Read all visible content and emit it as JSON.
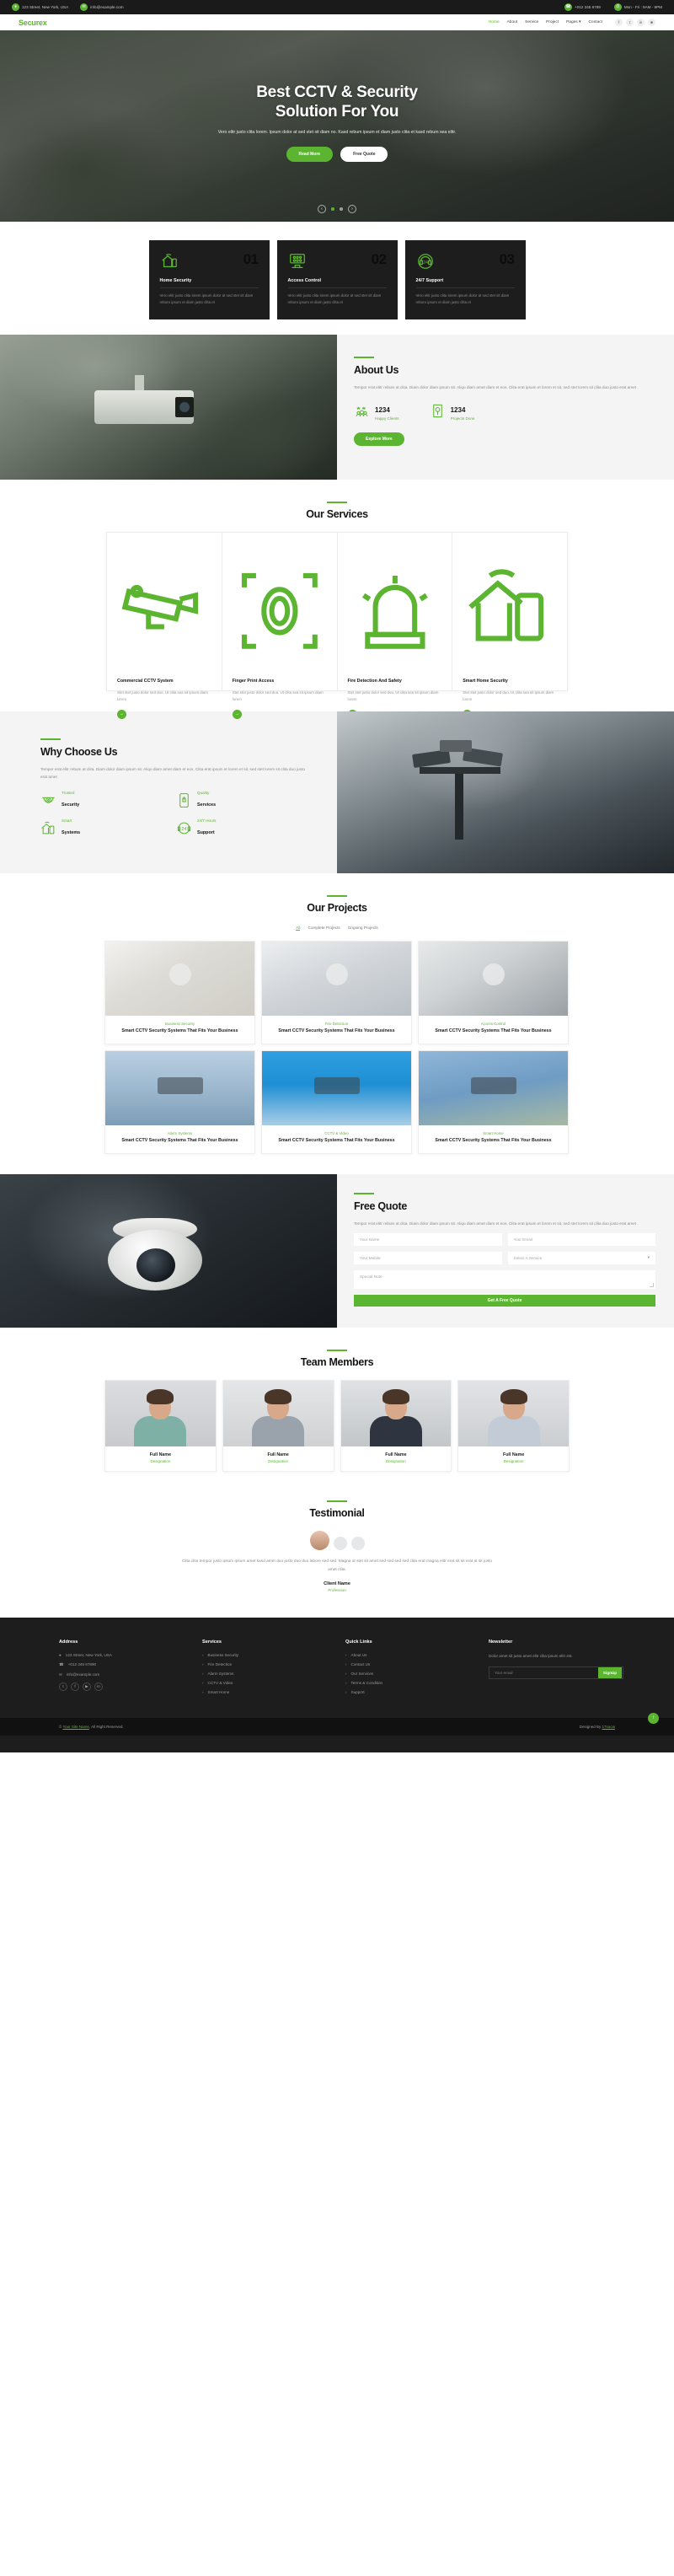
{
  "topbar": {
    "address": "123 Street, New York, USA",
    "email": "info@example.com",
    "phone": "+012 345 6789",
    "hours": "Mon - Fri : 9AM - 9PM"
  },
  "nav": {
    "logo": "Securex",
    "links": [
      {
        "label": "Home",
        "active": true
      },
      {
        "label": "About",
        "active": false
      },
      {
        "label": "Service",
        "active": false
      },
      {
        "label": "Project",
        "active": false
      },
      {
        "label": "Pages",
        "active": false,
        "caret": true
      },
      {
        "label": "Contact",
        "active": false
      }
    ],
    "social": [
      "f",
      "t",
      "in",
      "ig"
    ]
  },
  "hero": {
    "title_line1": "Best CCTV & Security",
    "title_line2": "Solution For You",
    "paragraph": "Vero elitr justo clita lorem. Ipsum dolor at sed stet sit diam no. Kasd rebum ipsum et diam justo clita et kasd rebum sea elitr.",
    "btn_primary": "Read More",
    "btn_secondary": "Free Quote"
  },
  "features": [
    {
      "title": "Home Security",
      "number": "01",
      "text": "Vero elitr justo clita lorem ipsum dolor at sed stet sit diam rebum ipsum et diam justo clita et",
      "icon": "home-wifi-icon"
    },
    {
      "title": "Access Control",
      "number": "02",
      "text": "Vero elitr justo clita lorem ipsum dolor at sed stet sit diam rebum ipsum et diam justo clita et",
      "icon": "keypad-icon"
    },
    {
      "title": "24/7 Support",
      "number": "03",
      "text": "Vero elitr justo clita lorem ipsum dolor at sed stet sit diam rebum ipsum et diam justo clita et",
      "icon": "headset-icon"
    }
  ],
  "about": {
    "title": "About Us",
    "paragraph": "Tempor erat elitr rebum at clita. Diam dolor diam ipsum sit. Aliqu diam amet diam et eos. Clita erat ipsum et lorem et sit, sed stet lorem sit clita duo justo erat amet",
    "stats": [
      {
        "number": "1234",
        "label": "Happy Clients",
        "icon": "clients-icon"
      },
      {
        "number": "1234",
        "label": "Projects Done",
        "icon": "project-icon"
      }
    ],
    "button": "Explore More"
  },
  "services": {
    "title": "Our Services",
    "items": [
      {
        "title": "Commercial CCTV System",
        "text": "Stet stet justo dolor sed duo. Ut clita sea sit ipsum diam lorem",
        "icon": "cctv-camera-icon"
      },
      {
        "title": "Finger Print Access",
        "text": "Stet stet justo dolor sed duo. Ut clita sea sit ipsum diam lorem",
        "icon": "fingerprint-icon"
      },
      {
        "title": "Fire Detection And Safety",
        "text": "Stet stet justo dolor sed duo. Ut clita sea sit ipsum diam lorem",
        "icon": "fire-alarm-icon"
      },
      {
        "title": "Smart Home Security",
        "text": "Stet stet justo dolor sed duo. Ut clita sea sit ipsum diam lorem",
        "icon": "smart-home-icon"
      }
    ]
  },
  "why": {
    "title": "Why Choose Us",
    "paragraph": "Tempor erat elitr rebum at clita. Diam dolor diam ipsum sit. Aliqu diam amet diam et eos. Clita erat ipsum et lorem et sit, sed stet lorem sit clita duo justo erat amet",
    "features": [
      {
        "small": "Trusted",
        "big": "Security",
        "icon": "dome-camera-icon"
      },
      {
        "small": "Quality",
        "big": "Services",
        "icon": "phone-lock-icon"
      },
      {
        "small": "Smart",
        "big": "Systems",
        "icon": "smart-home-icon"
      },
      {
        "small": "24/7 Hours",
        "big": "Support",
        "icon": "headset-icon"
      }
    ]
  },
  "projects": {
    "title": "Our Projects",
    "filters": [
      {
        "label": "All",
        "active": true
      },
      {
        "label": "Complete Projects",
        "active": false
      },
      {
        "label": "Ongoing Projects",
        "active": false
      }
    ],
    "items": [
      {
        "category": "Business Security",
        "title": "Smart CCTV Security Systems That Fits Your Business"
      },
      {
        "category": "Fire Detection",
        "title": "Smart CCTV Security Systems That Fits Your Business"
      },
      {
        "category": "Access Control",
        "title": "Smart CCTV Security Systems That Fits Your Business"
      },
      {
        "category": "Alarm Systems",
        "title": "Smart CCTV Security Systems That Fits Your Business"
      },
      {
        "category": "CCTV & Video",
        "title": "Smart CCTV Security Systems That Fits Your Business"
      },
      {
        "category": "Smart Home",
        "title": "Smart CCTV Security Systems That Fits Your Business"
      }
    ]
  },
  "quote": {
    "title": "Free Quote",
    "paragraph": "Tempor erat elitr rebum at clita. Diam dolor diam ipsum sit. Aliqu diam amet diam et eos. Clita erat ipsum et lorem et sit, sed stet lorem sit clita duo justo erat amet",
    "name_placeholder": "Your Name",
    "email_placeholder": "Your Email",
    "mobile_placeholder": "Your Mobile",
    "service_placeholder": "Select A Service",
    "note_placeholder": "Special Note",
    "submit": "Get A Free Quote"
  },
  "team": {
    "title": "Team Members",
    "members": [
      {
        "name": "Full Name",
        "designation": "Designation"
      },
      {
        "name": "Full Name",
        "designation": "Designation"
      },
      {
        "name": "Full Name",
        "designation": "Designation"
      },
      {
        "name": "Full Name",
        "designation": "Designation"
      }
    ]
  },
  "testimonial": {
    "title": "Testimonial",
    "quote": "Clita clita tempor justo ipsum ipsum amet kasd amet duo justo duo duo labore sed sed. Magna ut stet sit amet sed sed sed sed clita erat magna elitr erat sit sit erat at sit justo amet clita.",
    "client_name": "Client Name",
    "client_profession": "Profession"
  },
  "footer": {
    "address": {
      "heading": "Address",
      "items": [
        {
          "icon": "location-pin-icon",
          "text": "123 Street, New York, USA"
        },
        {
          "icon": "phone-icon",
          "text": "+012 345 67890"
        },
        {
          "icon": "envelope-icon",
          "text": "info@example.com"
        }
      ],
      "social": [
        "t",
        "f",
        "yt",
        "in"
      ]
    },
    "services": {
      "heading": "Services",
      "items": [
        "Business Security",
        "Fire Detection",
        "Alarm Systems",
        "CCTV & Video",
        "Smart Home"
      ]
    },
    "quick": {
      "heading": "Quick Links",
      "items": [
        "About Us",
        "Contact Us",
        "Our Services",
        "Terms & Condition",
        "Support"
      ]
    },
    "newsletter": {
      "heading": "Newsletter",
      "text": "Dolor amet sit justo amet elitr clita ipsum elitr est.",
      "placeholder": "Your email",
      "button": "SignUp"
    },
    "copyright_prefix": "© ",
    "copyright_link": "Your Site Name",
    "copyright_suffix": ", All Right Reserved.",
    "designed_prefix": "Designed By ",
    "designed_link": "17sucai"
  },
  "colors": {
    "accent": "#5cb531",
    "dark": "#1d1d1d",
    "darker": "#111111"
  }
}
